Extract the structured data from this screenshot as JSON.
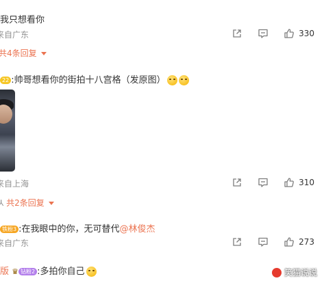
{
  "comments": [
    {
      "text": "我只想看你",
      "source": "来自广东",
      "replies_label": "共4条回复",
      "likes": "330"
    },
    {
      "badge": "22",
      "text": ":帅哥想看你的街拍十八宫格（发原图）",
      "source": "来自上海",
      "replies_label": "共2条回复",
      "likes": "310"
    },
    {
      "badge": "铁粉3",
      "text": ":在我眼中的你，无可替代",
      "mention": "@林俊杰",
      "source": "来自广东",
      "likes": "273"
    },
    {
      "prefix": "版",
      "badge": "钻粉2",
      "text": ":多拍你自己"
    }
  ],
  "watermark": "笑猫说说",
  "colors": {
    "accent": "#eb7350",
    "meta": "#939393",
    "text": "#333333",
    "fan_badge": "#b37feb",
    "gold_badge": "#f6a623"
  }
}
